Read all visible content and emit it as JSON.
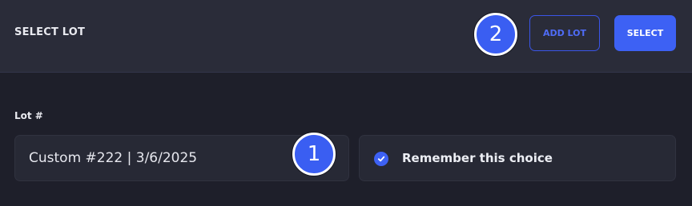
{
  "header": {
    "title": "SELECT LOT",
    "add_lot_label": "ADD LOT",
    "select_label": "SELECT"
  },
  "form": {
    "lot_label": "Lot #",
    "lot_value": "Custom #222 | 3/6/2025",
    "remember_label": "Remember this choice",
    "remember_checked": true
  },
  "annotations": {
    "badge_1": "1",
    "badge_2": "2"
  },
  "colors": {
    "accent": "#3d61f4",
    "background": "#1e1f2a",
    "header_bg": "#2a2c39",
    "field_bg": "#272935"
  },
  "icons": {
    "remember_check": "check-circle-icon"
  }
}
